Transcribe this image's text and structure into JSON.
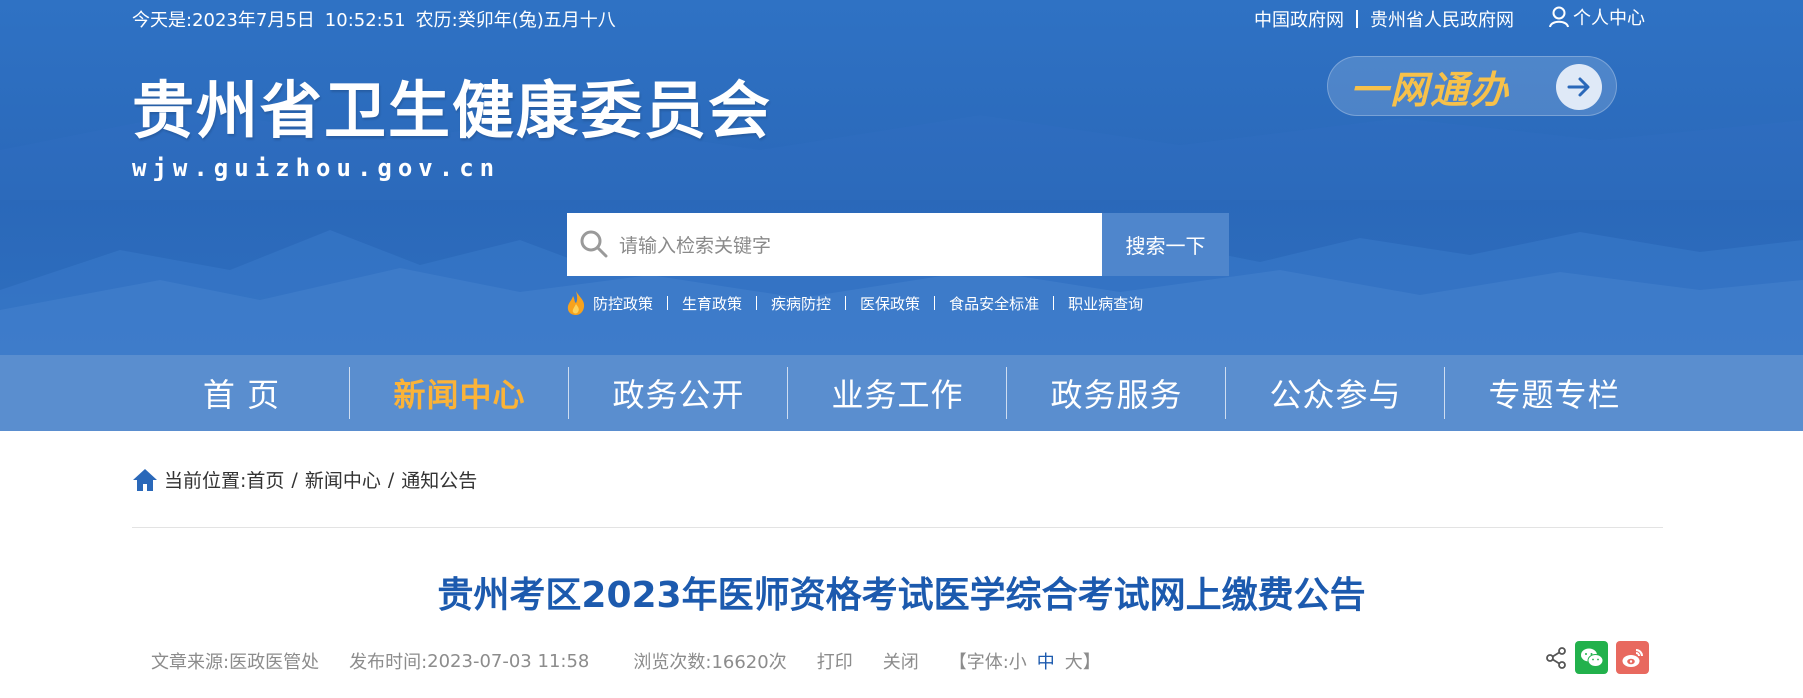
{
  "topbar": {
    "date_label": "今天是:",
    "date": "2023年7月5日",
    "time": "10:52:51",
    "lunar_label": "农历:",
    "lunar": "癸卯年(兔)五月十八",
    "links": [
      "中国政府网",
      "贵州省人民政府网"
    ],
    "user_center": "个人中心"
  },
  "logo": {
    "cn": "贵州省卫生健康委员会",
    "en": "wjw.guizhou.gov.cn"
  },
  "yiwang": {
    "label": "一网通办"
  },
  "search": {
    "placeholder": "请输入检索关键字",
    "button": "搜索一下"
  },
  "hotlinks": [
    "防控政策",
    "生育政策",
    "疾病防控",
    "医保政策",
    "食品安全标准",
    "职业病查询"
  ],
  "nav": [
    "首 页",
    "新闻中心",
    "政务公开",
    "业务工作",
    "政务服务",
    "公众参与",
    "专题专栏"
  ],
  "nav_active": "新闻中心",
  "breadcrumb": {
    "label": "当前位置:",
    "items": [
      "首页",
      "新闻中心",
      "通知公告"
    ]
  },
  "article": {
    "title": "贵州考区2023年医师资格考试医学综合考试网上缴费公告",
    "source_label": "文章来源:",
    "source": "医政医管处",
    "published_label": "发布时间:",
    "published": "2023-07-03 11:58",
    "views_label": "浏览次数:",
    "views": "16620次",
    "print": "打印",
    "close": "关闭",
    "font_label": "【字体:",
    "font_small": "小",
    "font_medium": "中",
    "font_large": "大】"
  },
  "colors": {
    "header_blue": "#2a68b9",
    "nav_blue": "#5a8ecf",
    "accent_orange": "#fbb338",
    "title_blue": "#1c5aae",
    "wechat_green": "#22b14c",
    "weibo_red": "#e8695f"
  }
}
